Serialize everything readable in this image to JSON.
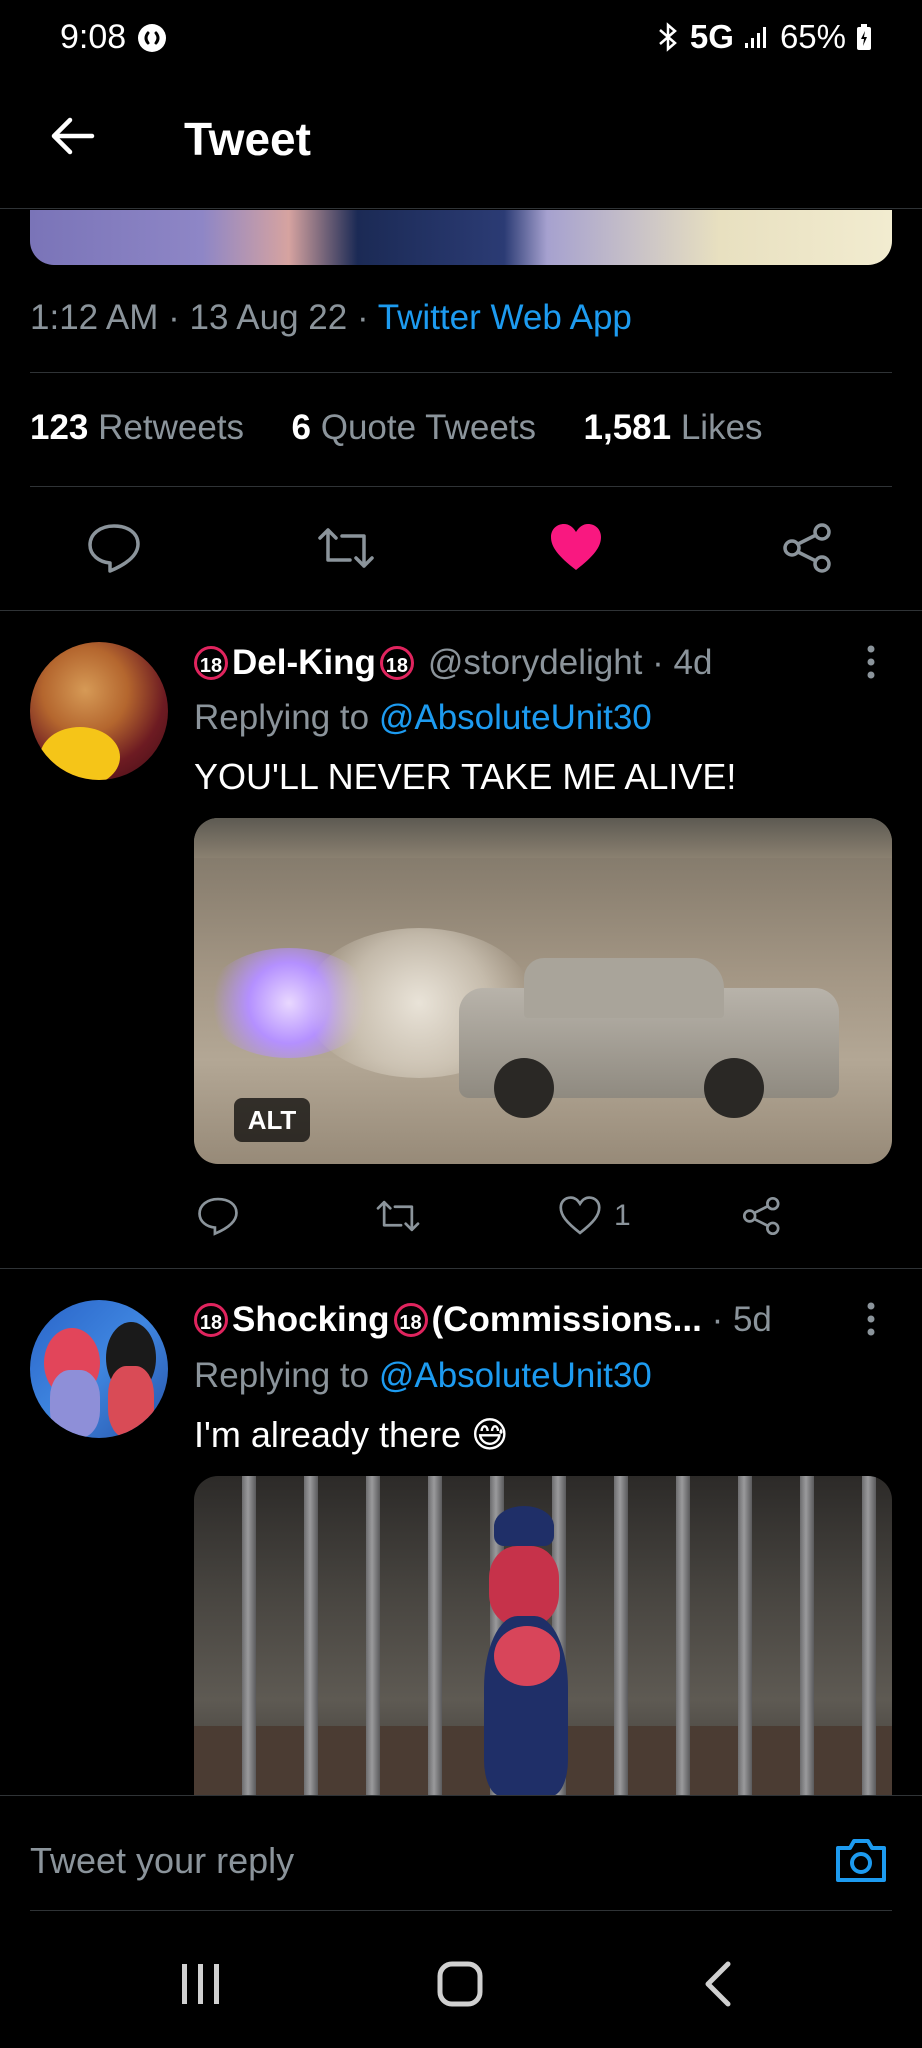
{
  "status_bar": {
    "time": "9:08",
    "network": "5G",
    "battery": "65%"
  },
  "header": {
    "title": "Tweet"
  },
  "tweet": {
    "time": "1:12 AM",
    "date": "13 Aug 22",
    "source": "Twitter Web App",
    "retweets_count": "123",
    "retweets_label": "Retweets",
    "quotes_count": "6",
    "quotes_label": "Quote Tweets",
    "likes_count": "1,581",
    "likes_label": "Likes",
    "liked": true,
    "like_color": "#f91880"
  },
  "replies": [
    {
      "display_name": "Del-King",
      "handle": "@storydelight",
      "age": "4d",
      "replying_prefix": "Replying to",
      "replying_to": "@AbsoluteUnit30",
      "text": "YOU'LL NEVER TAKE ME ALIVE!",
      "media_alt_badge": "ALT",
      "like_count": "1"
    },
    {
      "display_name": "Shocking",
      "name_suffix": "(Commissions...",
      "age": "5d",
      "replying_prefix": "Replying to",
      "replying_to": "@AbsoluteUnit30",
      "text": "I'm already there",
      "emoji": "😅"
    }
  ],
  "badge_text": "18",
  "reply_bar": {
    "placeholder": "Tweet your reply"
  },
  "colors": {
    "background": "#000000",
    "accent": "#1d9bf0",
    "muted": "#8b949b",
    "like": "#f91880",
    "badge_ring": "#e0245e"
  }
}
